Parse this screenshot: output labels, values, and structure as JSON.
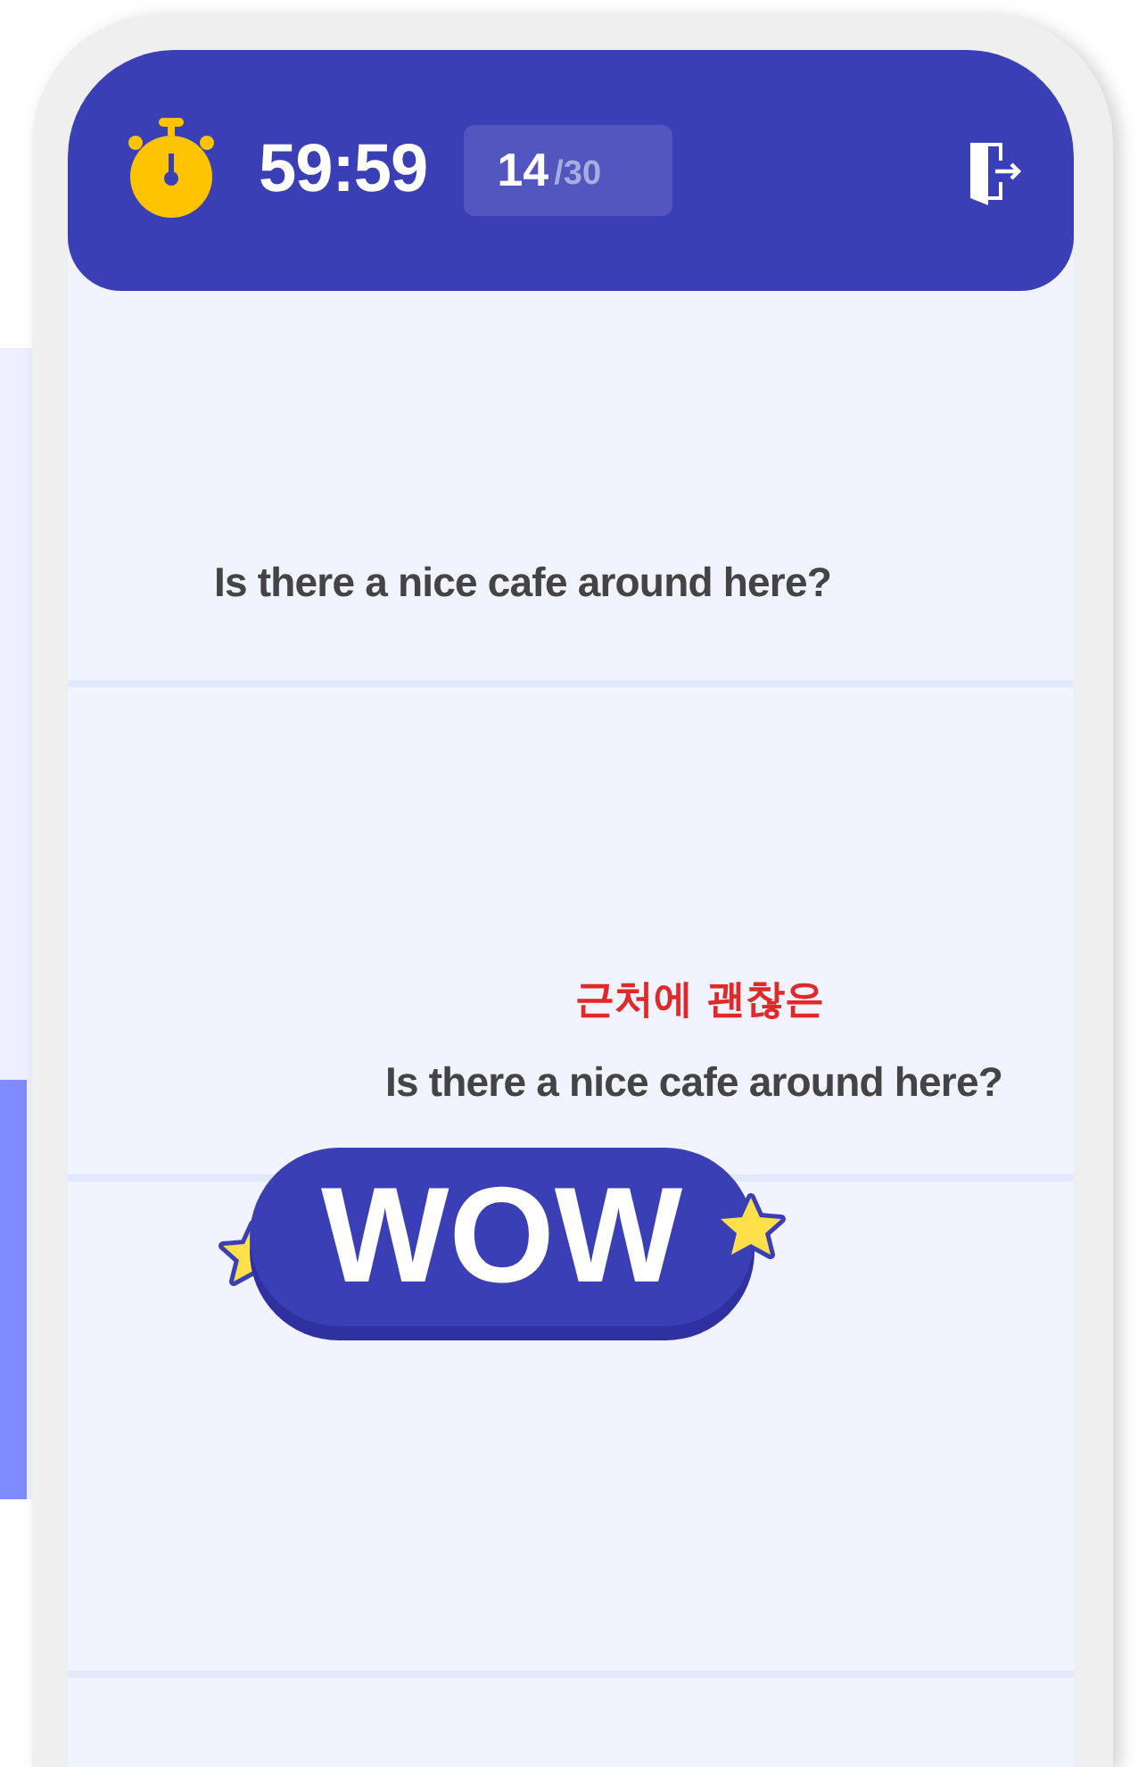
{
  "header": {
    "timer": "59:59",
    "progress": {
      "current": "14",
      "total": "/30"
    }
  },
  "rows": [
    {
      "kind": "question",
      "text": "Is there a nice cafe around here?"
    },
    {
      "kind": "answer",
      "hint": "근처에 괜찮은",
      "text": "Is there a nice cafe around here?"
    },
    {
      "kind": "empty"
    },
    {
      "kind": "empty"
    }
  ],
  "sticker": {
    "text": "WOW"
  }
}
